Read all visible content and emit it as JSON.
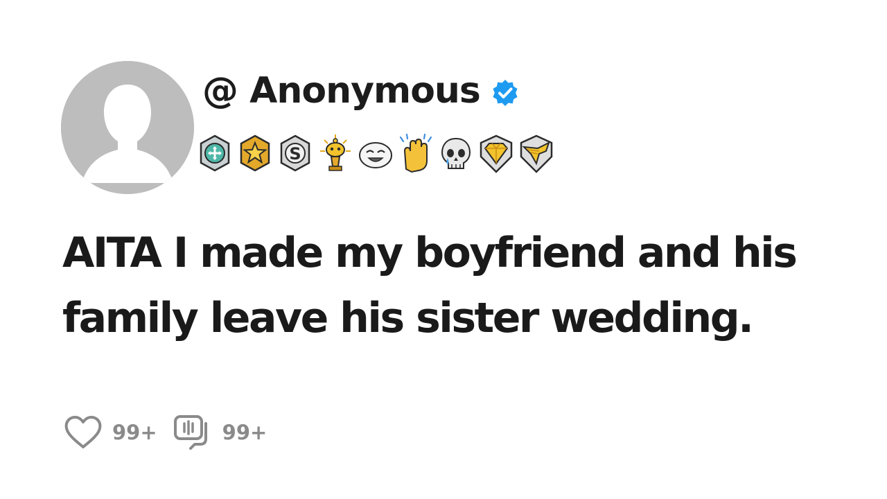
{
  "post": {
    "username": "@ Anonymous",
    "verified": true,
    "title_line1": "AITA I made my boyfriend and his",
    "title_line2": "family leave his sister wedding.",
    "awards": [
      "helpful-award-icon",
      "gold-star-award-icon",
      "s-coin-award-icon",
      "gold-snoo-trophy-award-icon",
      "laughing-face-award-icon",
      "clapping-hands-award-icon",
      "crying-skull-award-icon",
      "gold-diamond-award-icon",
      "gold-wings-award-icon"
    ]
  },
  "actions": {
    "like_count": "99+",
    "comment_count": "99+"
  },
  "colors": {
    "verified_blue": "#1d9bf0",
    "muted_gray": "#8a8a8a",
    "avatar_bg": "#bdbdbd",
    "gold": "#f2c32c"
  }
}
